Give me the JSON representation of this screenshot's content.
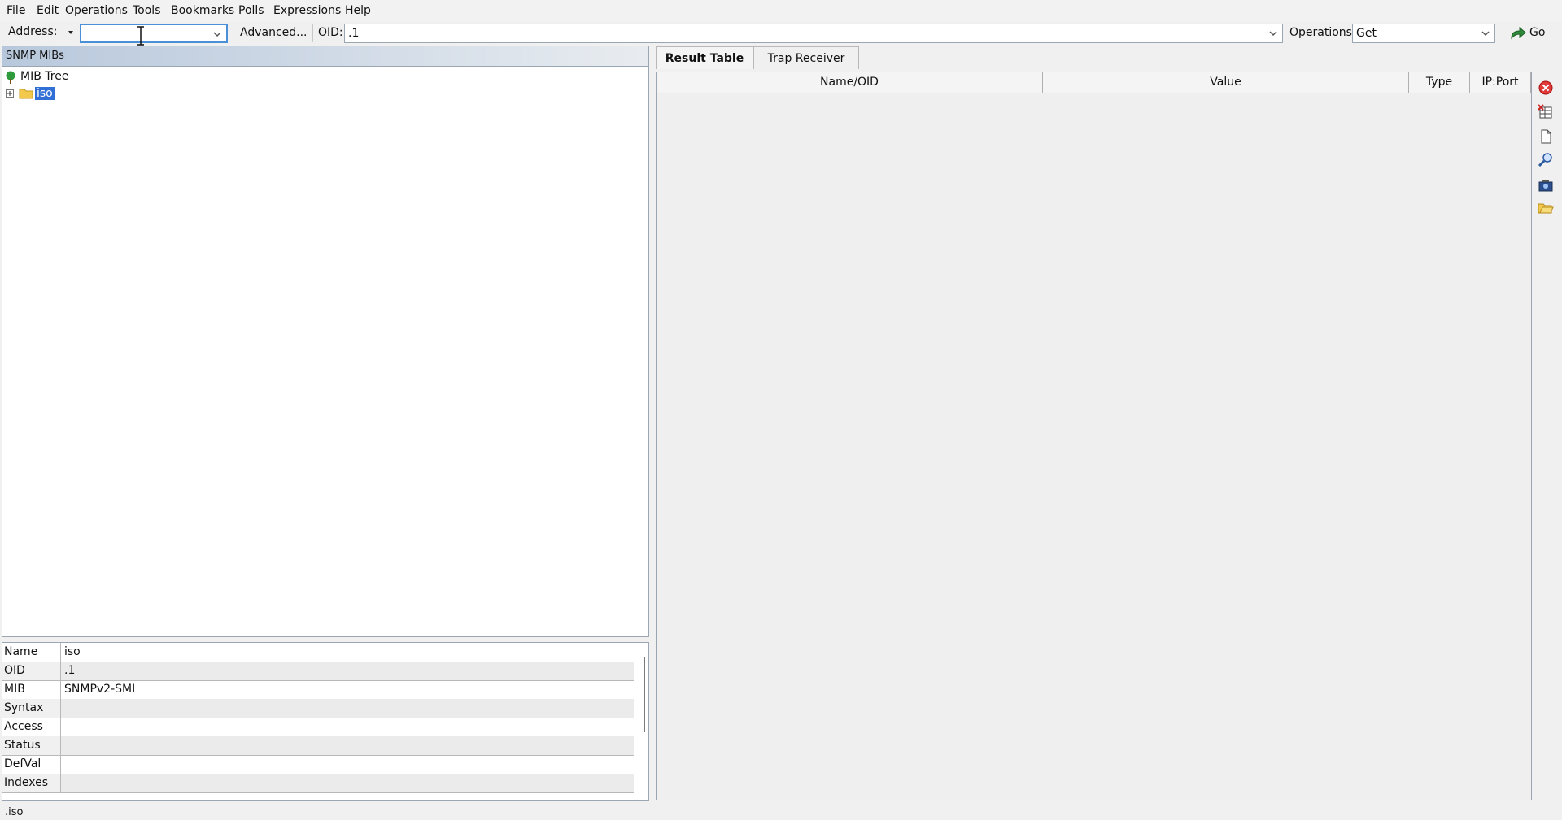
{
  "menu": [
    "File",
    "Edit",
    "Operations",
    "Tools",
    "Bookmarks",
    "Polls",
    "Expressions",
    "Help"
  ],
  "toolbar": {
    "address_label": "Address:",
    "address_value": "",
    "advanced_label": "Advanced...",
    "oid_label": "OID:",
    "oid_value": ".1",
    "operations_label": "Operations:",
    "operations_value": "Get",
    "go_label": "Go"
  },
  "left_panel": {
    "title": "SNMP MIBs",
    "tree": {
      "root_label": "MIB Tree",
      "node_label": "iso"
    }
  },
  "properties": [
    {
      "key": "Name",
      "value": "iso"
    },
    {
      "key": "OID",
      "value": ".1"
    },
    {
      "key": "MIB",
      "value": "SNMPv2-SMI"
    },
    {
      "key": "Syntax",
      "value": ""
    },
    {
      "key": "Access",
      "value": ""
    },
    {
      "key": "Status",
      "value": ""
    },
    {
      "key": "DefVal",
      "value": ""
    },
    {
      "key": "Indexes",
      "value": ""
    }
  ],
  "tabs": [
    "Result Table",
    "Trap Receiver"
  ],
  "result_table": {
    "columns": [
      "Name/OID",
      "Value",
      "Type",
      "IP:Port"
    ],
    "rows": []
  },
  "side_icons": [
    "close-icon",
    "clear-table-icon",
    "document-icon",
    "search-icon",
    "export-icon",
    "open-folder-icon"
  ],
  "status": {
    "text": ".iso"
  }
}
